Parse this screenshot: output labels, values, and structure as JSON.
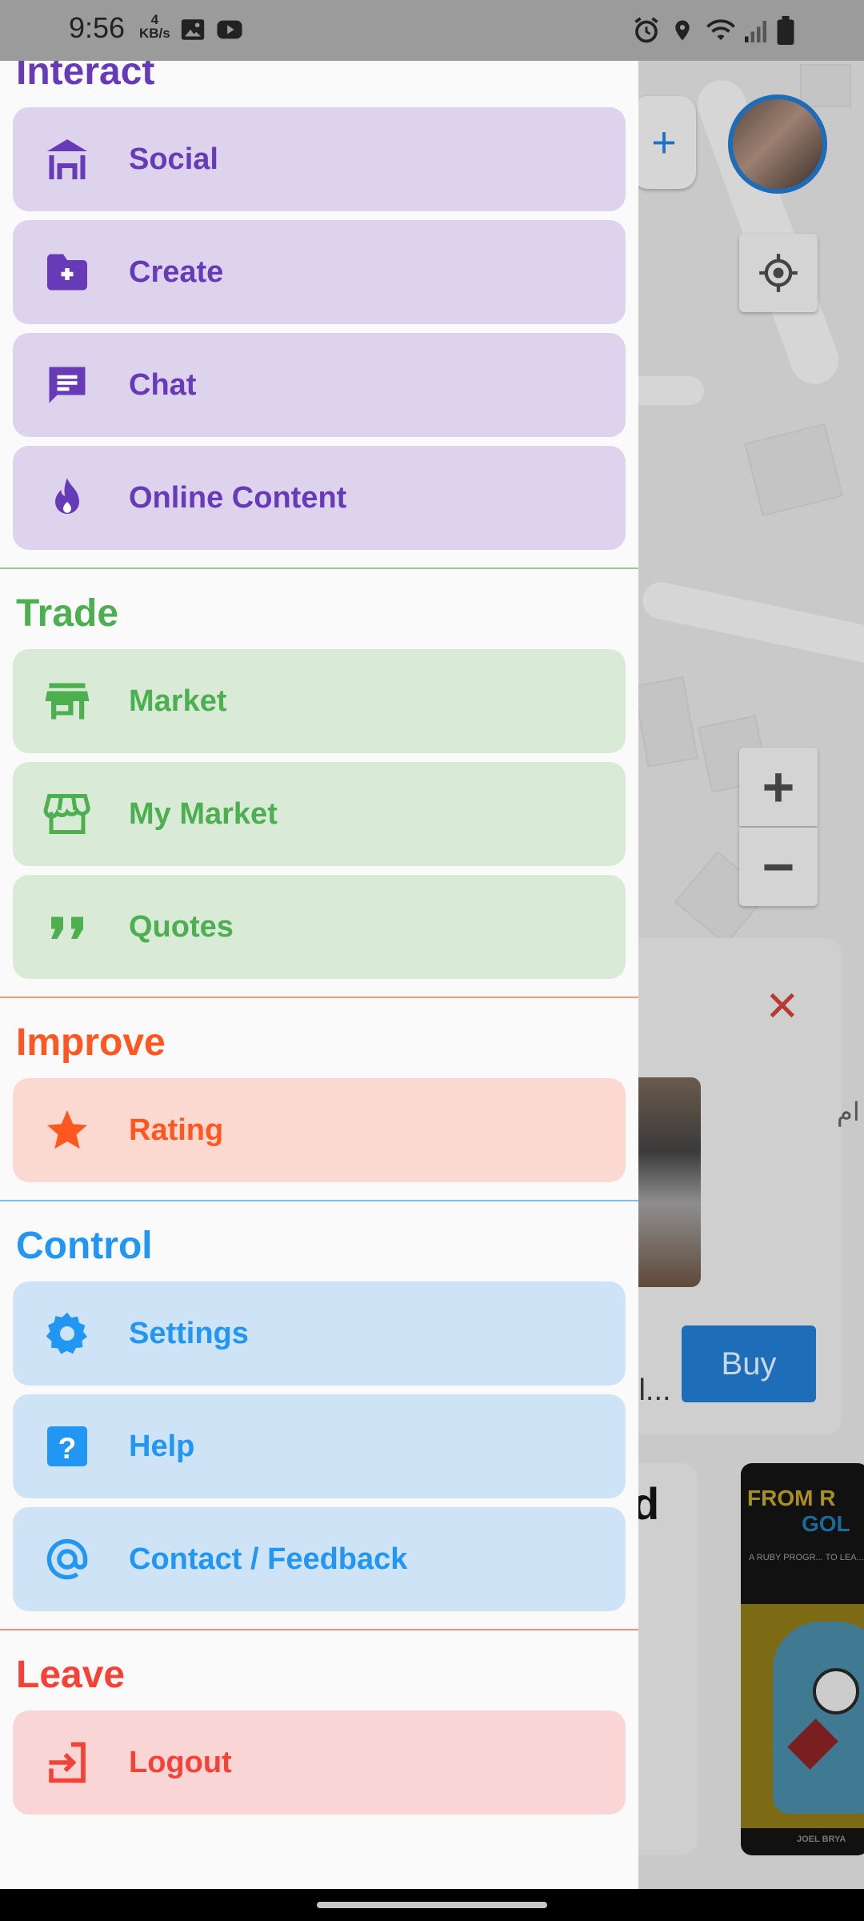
{
  "status_bar": {
    "time": "9:56",
    "speed_value": "4",
    "speed_unit": "KB/s"
  },
  "drawer": {
    "sections": [
      {
        "title": "Interact",
        "color": "#673ab7",
        "item_bg": "#ddd3ec",
        "items": [
          {
            "label": "Social",
            "icon": "deck-icon"
          },
          {
            "label": "Create",
            "icon": "create-folder-icon"
          },
          {
            "label": "Chat",
            "icon": "chat-icon"
          },
          {
            "label": "Online Content",
            "icon": "fire-icon"
          }
        ]
      },
      {
        "title": "Trade",
        "color": "#4caf50",
        "item_bg": "#d9ebd6",
        "items": [
          {
            "label": "Market",
            "icon": "store-icon"
          },
          {
            "label": "My Market",
            "icon": "storefront-icon"
          },
          {
            "label": "Quotes",
            "icon": "quote-icon"
          }
        ]
      },
      {
        "title": "Improve",
        "color": "#ff5722",
        "item_bg": "#fbd9d0",
        "items": [
          {
            "label": "Rating",
            "icon": "star-icon"
          }
        ]
      },
      {
        "title": "Control",
        "color": "#2196f3",
        "item_bg": "#cfe3f6",
        "items": [
          {
            "label": "Settings",
            "icon": "gear-icon"
          },
          {
            "label": "Help",
            "icon": "help-icon"
          },
          {
            "label": "Contact / Feedback",
            "icon": "at-icon"
          }
        ]
      },
      {
        "title": "Leave",
        "color": "#f44336",
        "item_bg": "#f9d6d5",
        "items": [
          {
            "label": "Logout",
            "icon": "logout-icon"
          }
        ]
      }
    ]
  },
  "background": {
    "buy_label": "Buy",
    "partial_text": "il...",
    "partial_heading": "d",
    "book_text_top": "FROM R",
    "book_text_second": "GOL",
    "book_subtitle": "A RUBY PROGR... TO LEA...",
    "book_author": "JOEL BRYA",
    "arabic_fragment": "ام",
    "zoom_in": "+",
    "zoom_out": "−",
    "close_glyph": "✕",
    "add_glyph": "+"
  }
}
